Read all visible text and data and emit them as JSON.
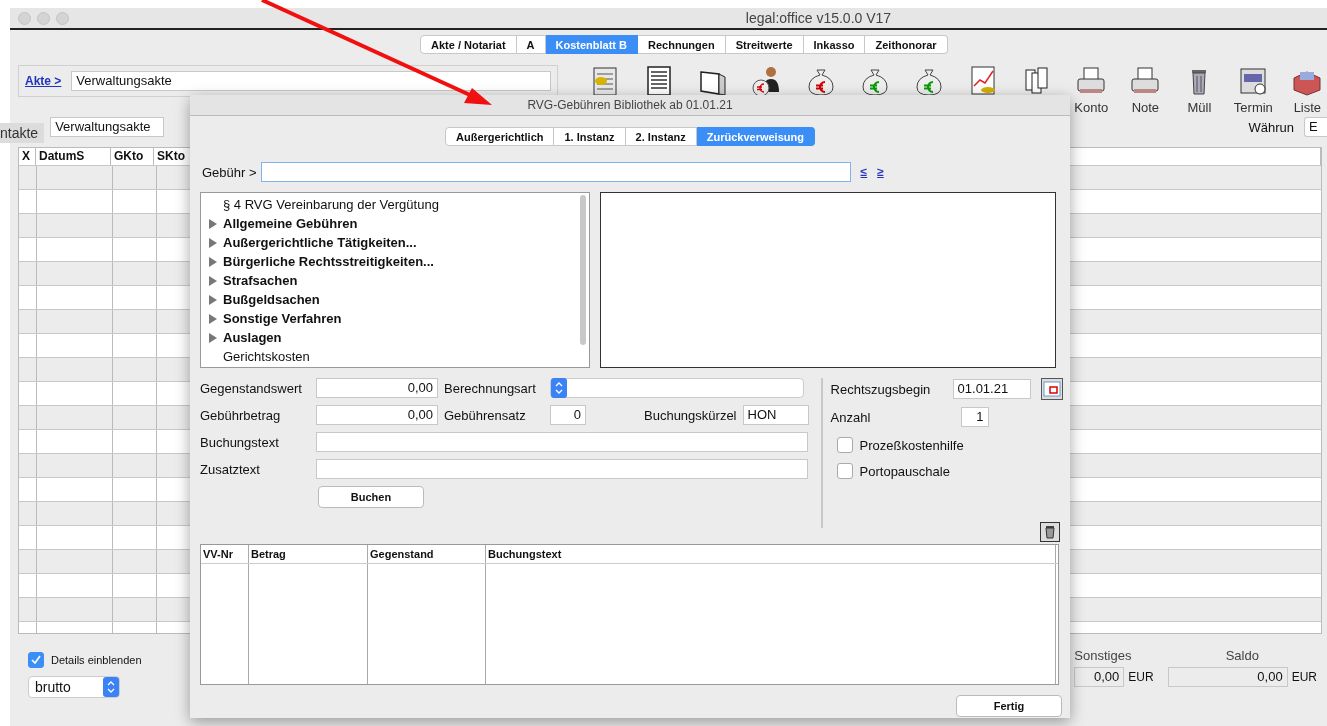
{
  "window": {
    "title": "legal:office v15.0.0 V17"
  },
  "main_tabs": [
    {
      "label": "Akte / Notariat",
      "selected": false
    },
    {
      "label": "A",
      "selected": false
    },
    {
      "label": "Kostenblatt B",
      "selected": true
    },
    {
      "label": "Rechnungen",
      "selected": false
    },
    {
      "label": "Streitwerte",
      "selected": false
    },
    {
      "label": "Inkasso",
      "selected": false
    },
    {
      "label": "Zeithonorar",
      "selected": false
    }
  ],
  "akte": {
    "link": "Akte >",
    "value": "Verwaltungsakte"
  },
  "toolbar": [
    {
      "kind": "ledger"
    },
    {
      "kind": "document"
    },
    {
      "kind": "briefcase"
    },
    {
      "kind": "person-euro"
    },
    {
      "kind": "moneybag-red"
    },
    {
      "kind": "moneybag-green"
    },
    {
      "kind": "moneybag-green"
    },
    {
      "kind": "chart"
    },
    {
      "kind": "files"
    },
    {
      "kind": "printer",
      "label": "Konto"
    },
    {
      "kind": "printer",
      "label": "Note"
    },
    {
      "kind": "trash",
      "label": "Müll"
    },
    {
      "kind": "calendar",
      "label": "Termin"
    },
    {
      "kind": "box",
      "label": "Liste"
    }
  ],
  "second_row": {
    "side_tab": "ntakte",
    "value": "Verwaltungsakte",
    "currency_label": "Währun",
    "currency_value": "E"
  },
  "main_table": {
    "columns": [
      "X",
      "DatumS",
      "GKto",
      "SKto"
    ]
  },
  "details": {
    "label": "Details einblenden",
    "checked": true
  },
  "mode_select": {
    "value": "brutto"
  },
  "totals": [
    {
      "label": "Sonstiges",
      "value": "0,00",
      "unit": "EUR"
    },
    {
      "label": "Saldo",
      "value": "0,00",
      "unit": "EUR"
    }
  ],
  "dialog": {
    "title": "RVG-Gebühren Bibliothek ab 01.01.21",
    "tabs": [
      {
        "label": "Außergerichtlich",
        "selected": false
      },
      {
        "label": "1. Instanz",
        "selected": false
      },
      {
        "label": "2. Instanz",
        "selected": false
      },
      {
        "label": "Zurückverweisung",
        "selected": true
      }
    ],
    "fee_label": "Gebühr >",
    "nav_links": [
      "≤",
      "≥"
    ],
    "tree": [
      {
        "label": "§ 4 RVG Vereinbarung der Vergütung",
        "kind": "entry"
      },
      {
        "label": "Allgemeine Gebühren",
        "kind": "group"
      },
      {
        "label": "Außergerichtliche Tätigkeiten...",
        "kind": "group"
      },
      {
        "label": "Bürgerliche Rechtsstreitigkeiten...",
        "kind": "group"
      },
      {
        "label": "Strafsachen",
        "kind": "group"
      },
      {
        "label": "Bußgeldsachen",
        "kind": "group"
      },
      {
        "label": "Sonstige Verfahren",
        "kind": "group"
      },
      {
        "label": "Auslagen",
        "kind": "group"
      },
      {
        "label": "Gerichtskosten",
        "kind": "entry"
      }
    ],
    "gegenstandswert": {
      "label": "Gegenstandswert",
      "value": "0,00"
    },
    "berechnungsart": {
      "label": "Berechnungsart"
    },
    "gebuehrbetrag": {
      "label": "Gebührbetrag",
      "value": "0,00"
    },
    "gebuehrensatz": {
      "label": "Gebührensatz",
      "value": "0"
    },
    "buchungskuerzel": {
      "label": "Buchungskürzel",
      "value": "HON"
    },
    "buchungstext": {
      "label": "Buchungstext"
    },
    "zusatztext": {
      "label": "Zusatztext"
    },
    "book_button": "Buchen",
    "rechtszugsbegin": {
      "label": "Rechtszugsbegin",
      "value": "01.01.21"
    },
    "anzahl": {
      "label": "Anzahl",
      "value": "1"
    },
    "options": [
      {
        "label": "Prozeßkostenhilfe",
        "checked": false
      },
      {
        "label": "Portopauschale",
        "checked": false
      }
    ],
    "table": {
      "columns": [
        "VV-Nr",
        "Betrag",
        "Gegenstand",
        "Buchungstext"
      ]
    },
    "done_button": "Fertig"
  }
}
